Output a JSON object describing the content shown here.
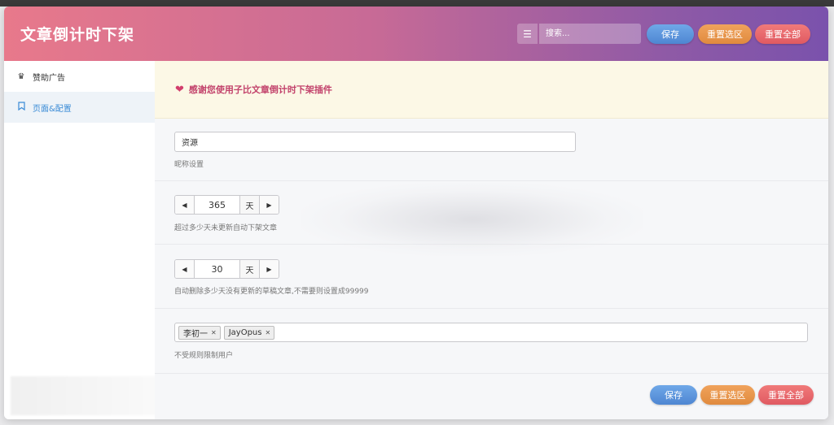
{
  "header": {
    "title": "文章倒计时下架",
    "search_placeholder": "搜索...",
    "save_label": "保存",
    "reset_section_label": "重置选区",
    "reset_all_label": "重置全部"
  },
  "sidebar": {
    "items": [
      {
        "label": "赞助广告",
        "icon": "crown-icon",
        "active": false
      },
      {
        "label": "页面&配置",
        "icon": "bookmark-icon",
        "active": true
      }
    ]
  },
  "notice": {
    "text": "感谢您使用子比文章倒计时下架插件"
  },
  "fields": {
    "nickname": {
      "value": "资源",
      "desc": "昵称设置"
    },
    "days_unpublish": {
      "value": "365",
      "unit": "天",
      "desc": "超过多少天未更新自动下架文章"
    },
    "days_delete_draft": {
      "value": "30",
      "unit": "天",
      "desc": "自动删除多少天没有更新的草稿文章,不需要则设置成99999"
    },
    "excluded_users": {
      "tags": [
        "李初一",
        "JayOpus"
      ],
      "desc": "不受规则限制用户"
    }
  },
  "footer": {
    "save_label": "保存",
    "reset_section_label": "重置选区",
    "reset_all_label": "重置全部"
  },
  "colors": {
    "save": "#5b93dc",
    "reset_section": "#e8924a",
    "reset_all": "#e8686e",
    "notice_text": "#c2426b",
    "active_nav": "#3a8bd6"
  }
}
